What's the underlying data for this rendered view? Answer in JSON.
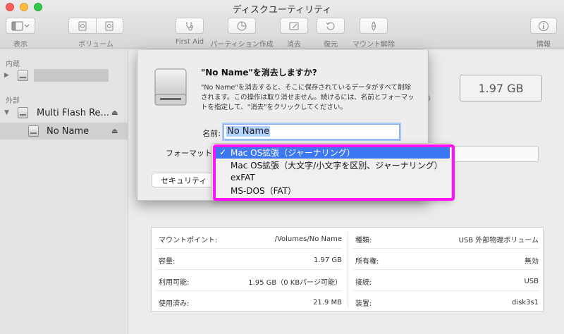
{
  "window": {
    "title": "ディスクユーティリティ"
  },
  "toolbar": {
    "view_label": "表示",
    "volume_label": "ボリューム",
    "first_aid_label": "First Aid",
    "partition_label": "パーティション作成",
    "erase_label": "消去",
    "restore_label": "復元",
    "unmount_label": "マウント解除",
    "info_label": "情報"
  },
  "sidebar": {
    "internal_header": "内蔵",
    "external_header": "外部",
    "items": [
      {
        "label": "Multi Flash Re..."
      },
      {
        "label": "No Name"
      }
    ]
  },
  "main": {
    "capacity_display": "1.97 GB",
    "partial_digit": "0",
    "info": [
      {
        "label": "マウントポイント:",
        "value": "/Volumes/No Name"
      },
      {
        "label": "容量:",
        "value": "1.97 GB"
      },
      {
        "label": "利用可能:",
        "value": "1.95 GB（0 KBパージ可能）"
      },
      {
        "label": "使用済み:",
        "value": "21.9 MB"
      },
      {
        "label": "種類:",
        "value": "USB 外部物理ボリューム"
      },
      {
        "label": "所有権:",
        "value": "無効"
      },
      {
        "label": "接続:",
        "value": "USB"
      },
      {
        "label": "装置:",
        "value": "disk3s1"
      }
    ]
  },
  "dialog": {
    "title": "\"No Name\"を消去しますか?",
    "body": "\"No Name\"を消去すると、そこに保存されているデータがすべて削除されます。この操作は取り消せません。続けるには、名前とフォーマットを指定して、\"消去\"をクリックしてください。",
    "name_label": "名前:",
    "name_value": "No Name",
    "format_label": "フォーマット",
    "security_button": "セキュリティ",
    "format_options": [
      "Mac OS拡張（ジャーナリング）",
      "Mac OS拡張（大文字/小文字を区別、ジャーナリング）",
      "exFAT",
      "MS-DOS（FAT）"
    ],
    "selected_index": 0,
    "check_glyph": "✓"
  },
  "colors": {
    "accent": "#3b78f2",
    "highlight": "#ff12f4"
  }
}
